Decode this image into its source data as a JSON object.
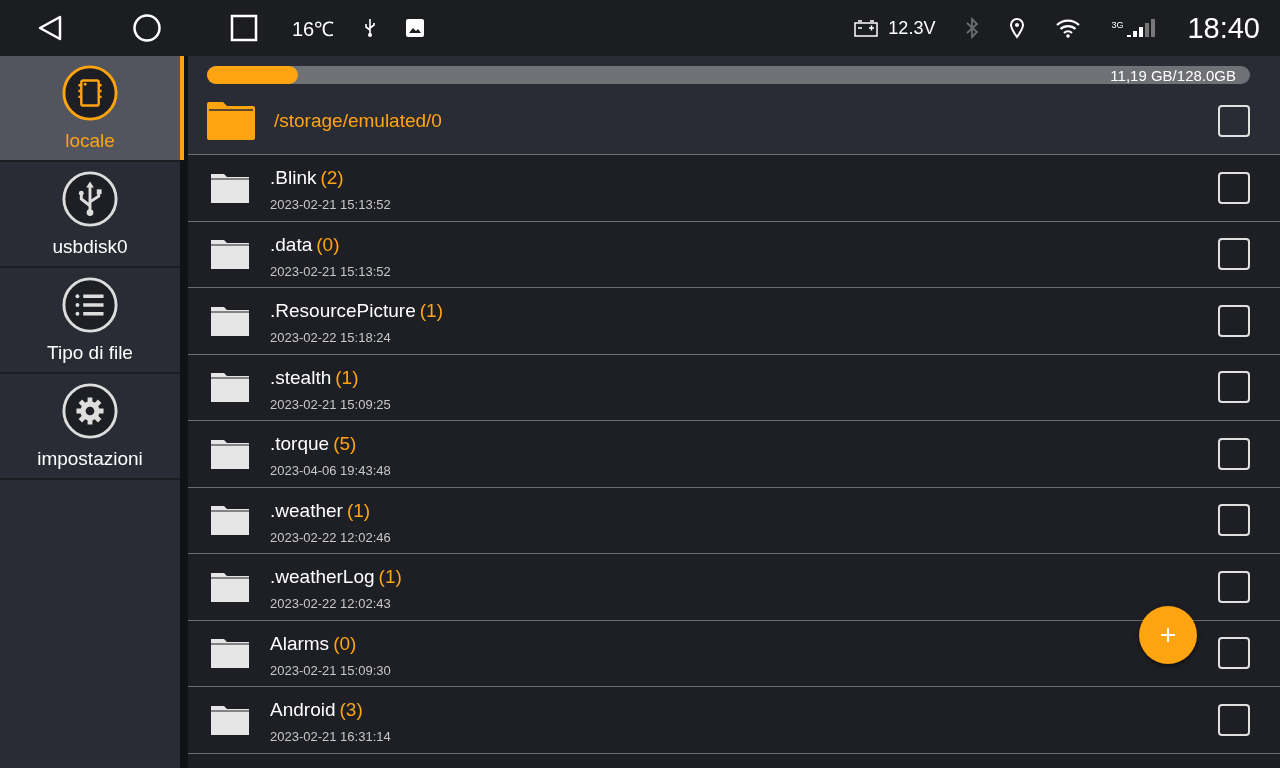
{
  "status_bar": {
    "temperature": "16℃",
    "voltage": "12.3V",
    "network_type": "3G",
    "time": "18:40"
  },
  "sidebar": {
    "items": [
      {
        "kind": "chip",
        "label": "locale",
        "selected": true
      },
      {
        "kind": "usb",
        "label": "usbdisk0",
        "selected": false
      },
      {
        "kind": "list",
        "label": "Tipo di file",
        "selected": false
      },
      {
        "kind": "gear",
        "label": "impostazioni",
        "selected": false
      }
    ]
  },
  "storage": {
    "level": 0.087,
    "reading": "11,19 GB/128.0GB"
  },
  "current_folder": {
    "path": "/storage/emulated/0",
    "checked": false
  },
  "files": [
    {
      "name": ".Blink",
      "count": "(2)",
      "date": "2023-02-21 15:13:52",
      "checked": false
    },
    {
      "name": ".data",
      "count": "(0)",
      "date": "2023-02-21 15:13:52",
      "checked": false
    },
    {
      "name": ".ResourcePicture",
      "count": "(1)",
      "date": "2023-02-22 15:18:24",
      "checked": false
    },
    {
      "name": ".stealth",
      "count": "(1)",
      "date": "2023-02-21 15:09:25",
      "checked": false
    },
    {
      "name": ".torque",
      "count": "(5)",
      "date": "2023-04-06 19:43:48",
      "checked": false
    },
    {
      "name": ".weather",
      "count": "(1)",
      "date": "2023-02-22 12:02:46",
      "checked": false
    },
    {
      "name": ".weatherLog",
      "count": "(1)",
      "date": "2023-02-22 12:02:43",
      "checked": false
    },
    {
      "name": "Alarms",
      "count": "(0)",
      "date": "2023-02-21 15:09:30",
      "checked": false
    },
    {
      "name": "Android",
      "count": "(3)",
      "date": "2023-02-21 16:31:14",
      "checked": false
    }
  ]
}
